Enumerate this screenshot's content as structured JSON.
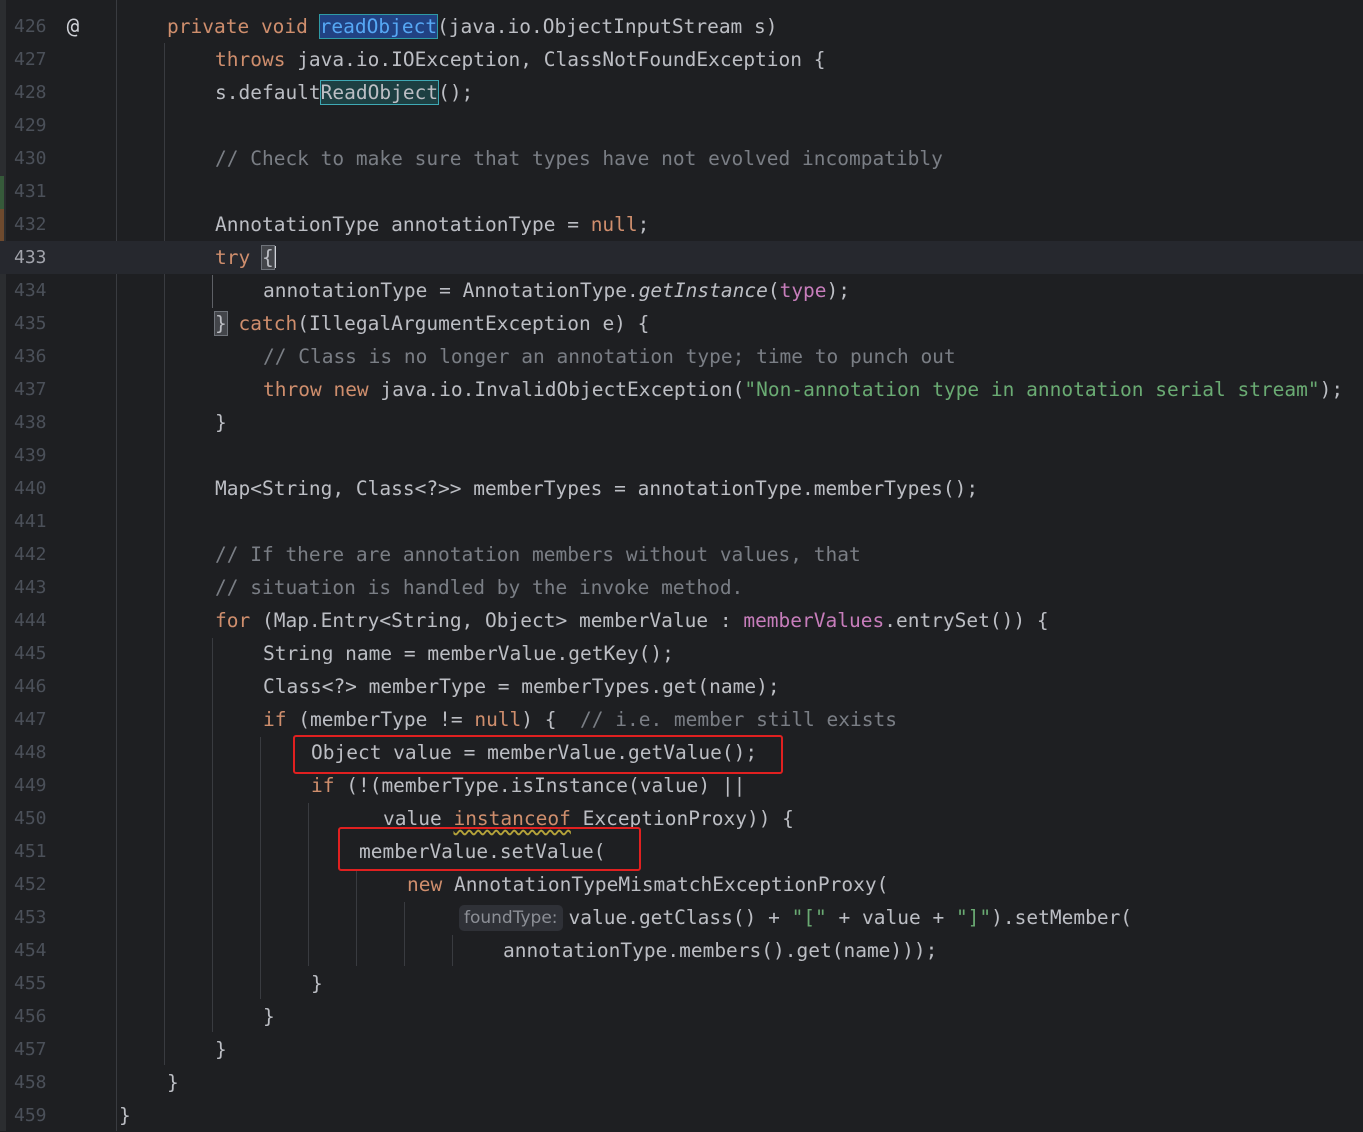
{
  "editor": {
    "language": "java",
    "current_line": 433,
    "gutter_icon": "at-sign-icon",
    "lines": [
      {
        "n": "426"
      },
      {
        "n": "427"
      },
      {
        "n": "428"
      },
      {
        "n": "429"
      },
      {
        "n": "430"
      },
      {
        "n": "431"
      },
      {
        "n": "432"
      },
      {
        "n": "433"
      },
      {
        "n": "434"
      },
      {
        "n": "435"
      },
      {
        "n": "436"
      },
      {
        "n": "437"
      },
      {
        "n": "438"
      },
      {
        "n": "439"
      },
      {
        "n": "440"
      },
      {
        "n": "441"
      },
      {
        "n": "442"
      },
      {
        "n": "443"
      },
      {
        "n": "444"
      },
      {
        "n": "445"
      },
      {
        "n": "446"
      },
      {
        "n": "447"
      },
      {
        "n": "448"
      },
      {
        "n": "449"
      },
      {
        "n": "450"
      },
      {
        "n": "451"
      },
      {
        "n": "452"
      },
      {
        "n": "453"
      },
      {
        "n": "454"
      },
      {
        "n": "455"
      },
      {
        "n": "456"
      },
      {
        "n": "457"
      },
      {
        "n": "458"
      },
      {
        "n": "459"
      }
    ],
    "code": {
      "l426": {
        "kw1": "private",
        "kw2": "void",
        "method": "readObject",
        "rest": "(java.io.ObjectInputStream s)"
      },
      "l427": {
        "kw": "throws",
        "rest": " java.io.IOException, ClassNotFoundException {"
      },
      "l428": {
        "pre": "s.default",
        "hl": "ReadObject",
        "rest": "();"
      },
      "l430": {
        "comment": "// Check to make sure that types have not evolved incompatibly"
      },
      "l432": {
        "pre": "AnnotationType annotationType = ",
        "kw": "null",
        "rest": ";"
      },
      "l433": {
        "kw": "try",
        "sp": " ",
        "brace": "{"
      },
      "l434": {
        "pre": "annotationType = AnnotationType.",
        "method": "getInstance",
        "p1": "(",
        "field": "type",
        "p2": ");"
      },
      "l435": {
        "brace": "}",
        "sp": " ",
        "kw": "catch",
        "rest": "(IllegalArgumentException e) {"
      },
      "l436": {
        "comment": "// Class is no longer an annotation type; time to punch out"
      },
      "l437": {
        "kw1": "throw",
        "kw2": "new",
        "rest": " java.io.InvalidObjectException(",
        "str": "\"Non-annotation type in annotation serial stream\"",
        "end": ");"
      },
      "l438": {
        "text": "}"
      },
      "l440": {
        "text": "Map<String, Class<?>> memberTypes = annotationType.memberTypes();"
      },
      "l442": {
        "comment": "// If there are annotation members without values, that"
      },
      "l443": {
        "comment": "// situation is handled by the invoke method."
      },
      "l444": {
        "kw": "for",
        "pre": " (Map.Entry<String, Object> memberValue : ",
        "field": "memberValues",
        "rest": ".entrySet()) {"
      },
      "l445": {
        "text": "String name = memberValue.getKey();"
      },
      "l446": {
        "text": "Class<?> memberType = memberTypes.get(name);"
      },
      "l447": {
        "kw": "if",
        "pre": " (memberType != ",
        "kw2": "null",
        "rest": ") {  ",
        "comment": "// i.e. member still exists"
      },
      "l448": {
        "text": "Object value = memberValue.getValue();"
      },
      "l449": {
        "kw": "if",
        "rest": " (!(memberType.isInstance(value) ||"
      },
      "l450": {
        "pre": "value ",
        "kw": "instanceof",
        "rest": " ExceptionProxy)) {"
      },
      "l451": {
        "text": "memberValue.setValue("
      },
      "l452": {
        "kw": "new",
        "rest": " AnnotationTypeMismatchExceptionProxy("
      },
      "l453": {
        "hint": "foundType:",
        "pre": "value.getClass() + ",
        "s1": "\"[\"",
        "mid": " + value + ",
        "s2": "\"]\"",
        "rest": ").setMember("
      },
      "l454": {
        "text": "annotationType.members().get(name)));"
      },
      "l455": {
        "text": "}"
      },
      "l456": {
        "text": "}"
      },
      "l457": {
        "text": "}"
      },
      "l458": {
        "text": "}"
      },
      "l459": {
        "text": "}"
      }
    },
    "colors": {
      "background": "#1e1f22",
      "keyword": "#cf8e6d",
      "comment": "#7a7e85",
      "string": "#6aab73",
      "method": "#56a8f5",
      "field": "#c77dbb",
      "annotation_box": "#e02020"
    }
  }
}
